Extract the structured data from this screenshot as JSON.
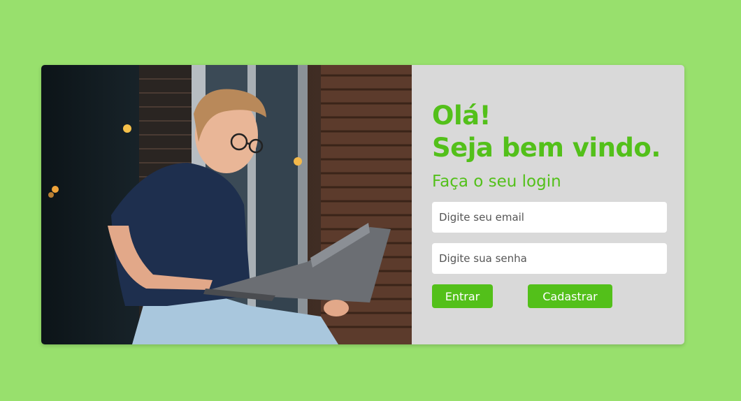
{
  "hero": {
    "alt": "Man with glasses using a laptop outdoors"
  },
  "form": {
    "greeting_line1": "Olá!",
    "greeting_line2": "Seja bem vindo.",
    "subtitle": "Faça o seu login",
    "email_placeholder": "Digite seu email",
    "password_placeholder": "Digite sua senha",
    "login_label": "Entrar",
    "signup_label": "Cadastrar"
  },
  "colors": {
    "background": "#98e06d",
    "accent": "#53c01a",
    "panel": "#d9d9d9"
  }
}
